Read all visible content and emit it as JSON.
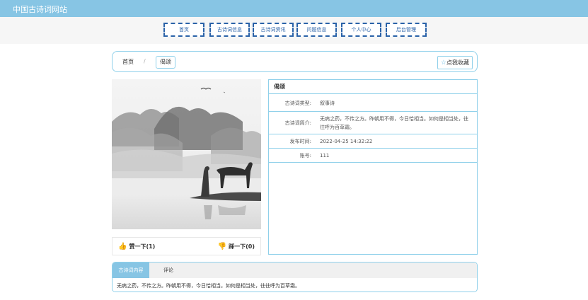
{
  "site": {
    "title": "中国古诗词网站"
  },
  "nav": {
    "items": [
      {
        "label": "首页"
      },
      {
        "label": "古诗词信息"
      },
      {
        "label": "古诗词资讯"
      },
      {
        "label": "问题信息"
      },
      {
        "label": "个人中心"
      },
      {
        "label": "后台管理"
      }
    ]
  },
  "breadcrumb": {
    "home": "首页",
    "separator": "/",
    "current": "偈颂"
  },
  "favorite": {
    "label": "点我收藏",
    "icon": "star-icon"
  },
  "votes": {
    "like_label": "赞一下(1)",
    "dislike_label": "踩一下(0)"
  },
  "info": {
    "title": "偈颂",
    "rows": [
      {
        "label": "古诗词类型:",
        "value": "叙事诗"
      },
      {
        "label": "古诗词简介:",
        "value": "无病之药，不传之方。昨朝用不得，今日恰相当。如何是相当处，往往呼为百草霜。"
      },
      {
        "label": "发布时间:",
        "value": "2022-04-25 14:32:22"
      },
      {
        "label": "账号:",
        "value": "111"
      }
    ]
  },
  "tabs": {
    "items": [
      {
        "label": "古诗词内容"
      },
      {
        "label": "评论"
      }
    ],
    "content": "无病之药，不传之方。昨朝用不得，今日恰相当。如何是相当处，往往呼为百草霜。"
  },
  "colors": {
    "accent": "#87c5e4",
    "border": "#8fd0ea",
    "nav_border": "#2a62a8",
    "like_icon": "#e23b3b"
  }
}
